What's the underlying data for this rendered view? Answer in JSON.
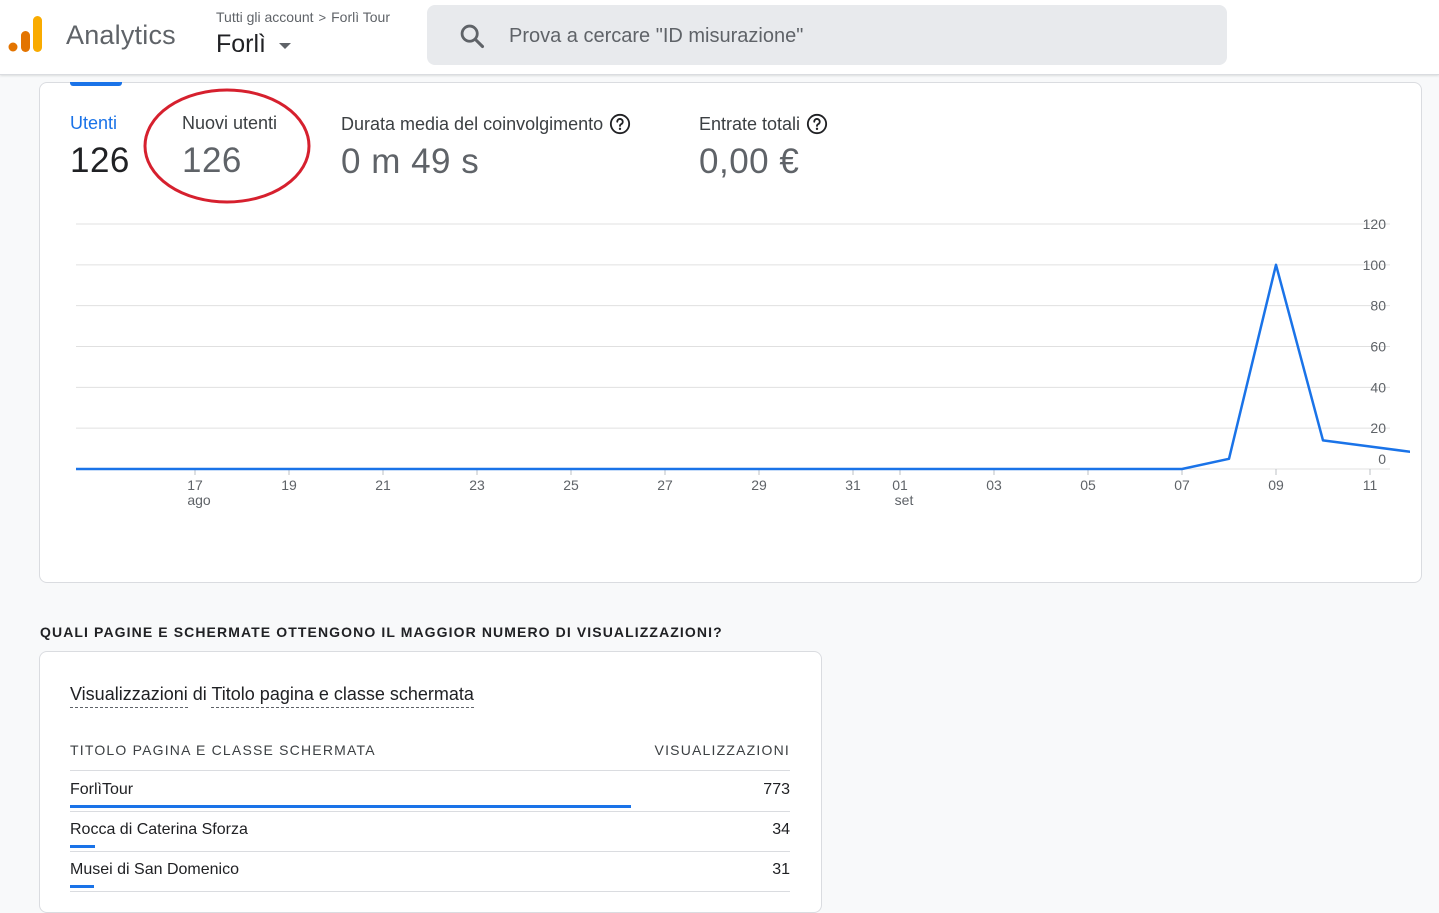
{
  "header": {
    "app_name": "Analytics",
    "breadcrumb_all_accounts": "Tutti gli account",
    "breadcrumb_separator": ">",
    "breadcrumb_account": "Forlì Tour",
    "property_name": "Forlì",
    "search_placeholder": "Prova a cercare \"ID misurazione\""
  },
  "metrics": [
    {
      "label": "Utenti",
      "value": "126",
      "active": true
    },
    {
      "label": "Nuovi utenti",
      "value": "126",
      "active": false
    },
    {
      "label": "Durata media del coinvolgimento",
      "value": "0 m 49 s",
      "active": false,
      "help": true
    },
    {
      "label": "Entrate totali",
      "value": "0,00 €",
      "active": false,
      "help": true
    }
  ],
  "chart_data": {
    "type": "line",
    "series": [
      {
        "color": "#1a73e8",
        "x": [
          "2023-08-15",
          "2023-08-16",
          "2023-08-17",
          "2023-08-18",
          "2023-08-19",
          "2023-08-20",
          "2023-08-21",
          "2023-08-22",
          "2023-08-23",
          "2023-08-24",
          "2023-08-25",
          "2023-08-26",
          "2023-08-27",
          "2023-08-28",
          "2023-08-29",
          "2023-08-30",
          "2023-08-31",
          "2023-09-01",
          "2023-09-02",
          "2023-09-03",
          "2023-09-04",
          "2023-09-05",
          "2023-09-06",
          "2023-09-07",
          "2023-09-08",
          "2023-09-09",
          "2023-09-10",
          "2023-09-11",
          "2023-09-12"
        ],
        "values": [
          0,
          0,
          0,
          0,
          0,
          0,
          0,
          0,
          0,
          0,
          0,
          0,
          0,
          0,
          0,
          0,
          0,
          0,
          0,
          0,
          0,
          0,
          0,
          0,
          5,
          100,
          14,
          11,
          8
        ]
      }
    ],
    "x_tick_labels": [
      "17",
      "19",
      "21",
      "23",
      "25",
      "27",
      "29",
      "31",
      "01",
      "03",
      "05",
      "07",
      "09",
      "11"
    ],
    "x_month_labels": [
      {
        "label": "ago",
        "under": "17"
      },
      {
        "label": "set",
        "under": "01"
      }
    ],
    "y_tick_labels": [
      "120",
      "100",
      "80",
      "60",
      "40",
      "20",
      "0"
    ],
    "ylim": [
      0,
      120
    ],
    "y_axis_side": "right",
    "grid": true
  },
  "pages_section": {
    "title": "QUALI PAGINE E SCHERMATE OTTENGONO IL MAGGIOR NUMERO DI VISUALIZZAZIONI?",
    "card_title_metric": "Visualizzazioni",
    "card_title_connector": "di",
    "card_title_dimension": "Titolo pagina e classe schermata",
    "col_title": "TITOLO PAGINA E CLASSE SCHERMATA",
    "col_views": "VISUALIZZAZIONI",
    "rows": [
      {
        "title": "ForlìTour",
        "views": "773",
        "share": 1.0
      },
      {
        "title": "Rocca di Caterina Sforza",
        "views": "34",
        "share": 0.044
      },
      {
        "title": "Musei di San Domenico",
        "views": "31",
        "share": 0.04
      }
    ]
  },
  "colors": {
    "accent": "#1a73e8",
    "annotation": "#d6202e",
    "logo_orange": "#f9ab00",
    "logo_dark_orange": "#e37400"
  }
}
